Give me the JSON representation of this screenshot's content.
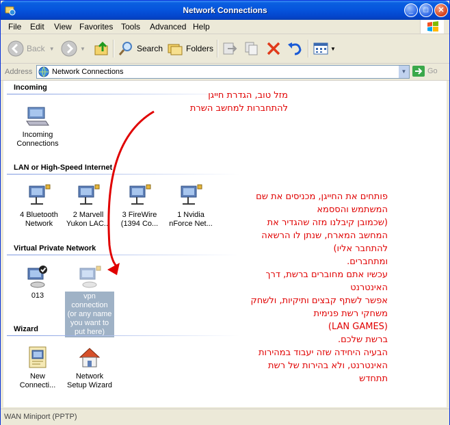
{
  "window": {
    "title": "Network Connections"
  },
  "menu": [
    "File",
    "Edit",
    "View",
    "Favorites",
    "Tools",
    "Advanced",
    "Help"
  ],
  "toolbar": {
    "back_label": "Back",
    "search_label": "Search",
    "folders_label": "Folders"
  },
  "address": {
    "label": "Address",
    "value": "Network Connections",
    "go_label": "Go"
  },
  "groups": {
    "incoming": {
      "title": "Incoming",
      "items": [
        {
          "label": "Incoming Connections"
        }
      ]
    },
    "lan": {
      "title": "LAN or High-Speed Internet",
      "items": [
        {
          "label": "4 Bluetooth Network"
        },
        {
          "label": "2 Marvell Yukon LAC..."
        },
        {
          "label": "3 FireWire (1394 Co..."
        },
        {
          "label": "1 Nvidia nForce Net..."
        }
      ]
    },
    "vpn": {
      "title": "Virtual Private Network",
      "items": [
        {
          "label": "013"
        },
        {
          "label": "vpn connection (or any name you want to put here)"
        }
      ]
    },
    "wizard": {
      "title": "Wizard",
      "items": [
        {
          "label": "New Connecti..."
        },
        {
          "label": "Network Setup Wizard"
        }
      ]
    }
  },
  "annotations": {
    "top": [
      "מזל טוב, הגדרת חייגן",
      "להתחברות למחשב השרת"
    ],
    "main": [
      "פותחים את החייגן, מכניסים את שם",
      "המשתמש והססמא",
      "(שכמובן קיבלנו מזה שהגדיר את",
      "המחשב המארח, שנתן לו הרשאה",
      "להתחבר אליו)",
      "ומתחברים.",
      "עכשיו אתם מחוברים ברשת, דרך",
      "האינטרנט",
      "אפשר לשתף קבצים ותיקיות, ולשחק",
      "משחקי רשת פנימית",
      "(LAN GAMES)",
      "ברשת שלכם.",
      "הבעיה היחידה שזה יעבוד במהירות",
      "האינטרנט, ולא בהירות של רשת",
      "תתחדש"
    ]
  },
  "status": {
    "text": "WAN Miniport (PPTP)"
  },
  "colors": {
    "titlebar": "#0553dc",
    "annotation": "#e00000",
    "selection": "#9fb2c6"
  }
}
